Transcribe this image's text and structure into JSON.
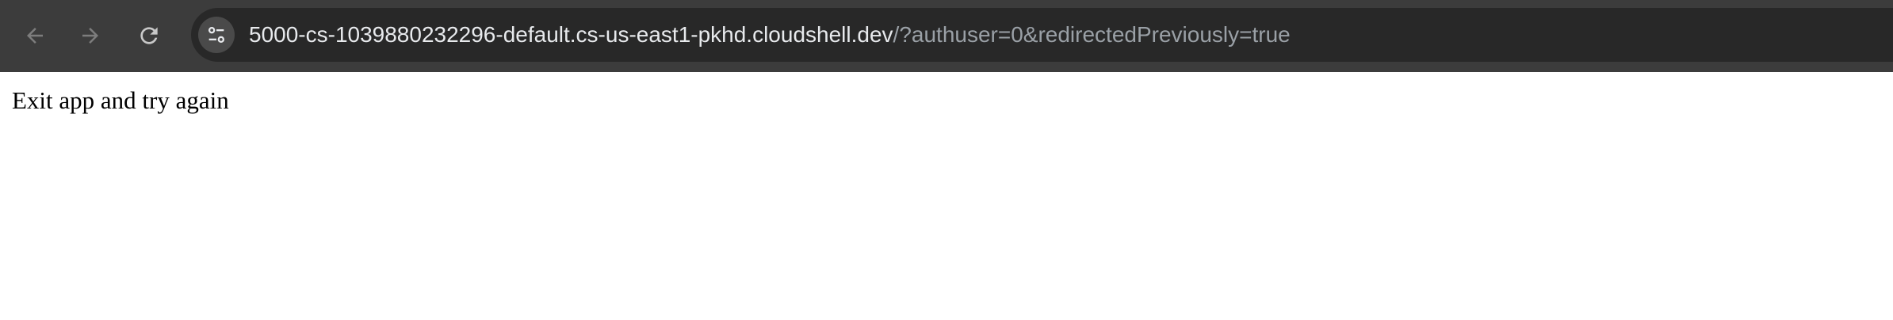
{
  "browser": {
    "url_host": "5000-cs-1039880232296-default.cs-us-east1-pkhd.cloudshell.dev",
    "url_rest": "/?authuser=0&redirectedPreviously=true",
    "back_icon": "arrow-left-icon",
    "forward_icon": "arrow-right-icon",
    "reload_icon": "reload-icon",
    "site_info_icon": "tune-icon",
    "toolbar_color": "#3c3c3c",
    "omnibox_color": "#282828"
  },
  "page": {
    "message": "Exit app and try again"
  }
}
